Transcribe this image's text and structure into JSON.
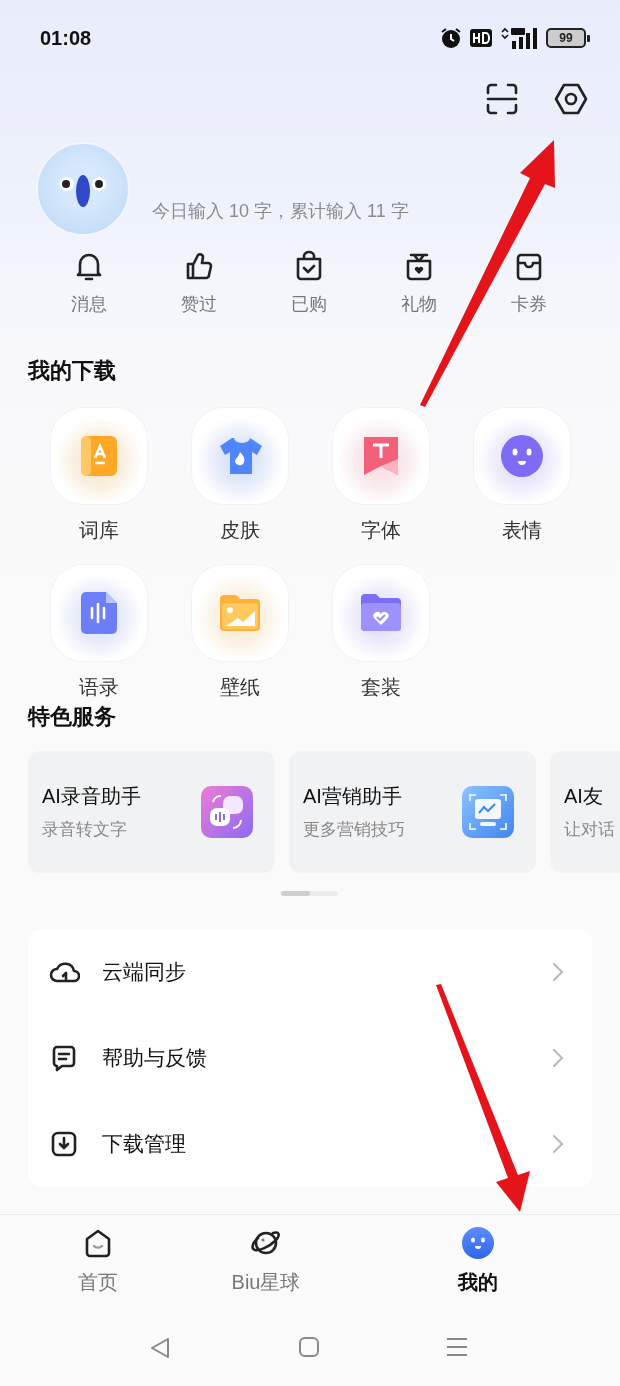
{
  "status_bar": {
    "time": "01:08",
    "battery": "99"
  },
  "profile": {
    "stats": "今日输入 10 字，累计输入 11 字"
  },
  "quick_actions": [
    {
      "label": "消息",
      "kind": "bell"
    },
    {
      "label": "赞过",
      "kind": "thumb"
    },
    {
      "label": "已购",
      "kind": "bag"
    },
    {
      "label": "礼物",
      "kind": "gift"
    },
    {
      "label": "卡券",
      "kind": "wallet"
    }
  ],
  "downloads": {
    "title": "我的下载",
    "items": [
      {
        "label": "词库",
        "kind": "book"
      },
      {
        "label": "皮肤",
        "kind": "shirt"
      },
      {
        "label": "字体",
        "kind": "font"
      },
      {
        "label": "表情",
        "kind": "face"
      },
      {
        "label": "语录",
        "kind": "voice"
      },
      {
        "label": "壁纸",
        "kind": "wallpaper"
      },
      {
        "label": "套装",
        "kind": "folder"
      }
    ]
  },
  "services": {
    "title": "特色服务",
    "cards": [
      {
        "title": "AI录音助手",
        "subtitle": "录音转文字",
        "kind": "voice"
      },
      {
        "title": "AI营销助手",
        "subtitle": "更多营销技巧",
        "kind": "chart"
      },
      {
        "title": "AI友",
        "subtitle": "让对话"
      }
    ]
  },
  "menu": [
    {
      "label": "云端同步",
      "kind": "cloud"
    },
    {
      "label": "帮助与反馈",
      "kind": "chat"
    },
    {
      "label": "下载管理",
      "kind": "download"
    }
  ],
  "tabs": [
    {
      "label": "首页",
      "kind": "home",
      "selected": false
    },
    {
      "label": "Biu星球",
      "kind": "planet",
      "selected": false
    },
    {
      "label": "我的",
      "kind": "face",
      "selected": true
    }
  ]
}
